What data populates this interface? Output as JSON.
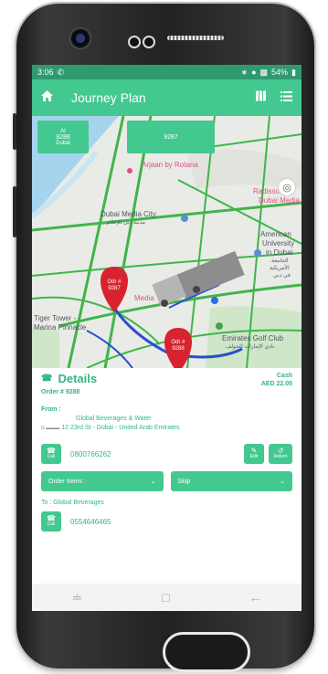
{
  "status": {
    "time": "3:06",
    "notification_icon": "whatsapp-icon",
    "battery": "54%"
  },
  "appbar": {
    "title": "Journey Plan",
    "icons": [
      "home-icon",
      "map-icon",
      "list-icon"
    ]
  },
  "map": {
    "tiles": [
      {
        "lines": [
          "At",
          "9288",
          "Dubai"
        ]
      },
      {
        "lines": [
          "9287"
        ]
      }
    ],
    "labels": {
      "arjaan": "Arjaan by Rotana",
      "media_city": "Dubai Media City",
      "media_city_ar": "مدينة دبي للإعلام",
      "radisson": "Radisson",
      "dubai_media_right": "Dubai Media",
      "american_univ": "American",
      "american_univ2": "University",
      "american_univ3": "in Dubai",
      "american_univ_ar1": "الجامعة",
      "american_univ_ar2": "الأمريكية",
      "american_univ_ar3": "في دبي",
      "media_small": "Media",
      "tiger_tower": "Tiger Tower -",
      "marina_pinnacle": "Marina Pinnacle",
      "golf_club": "Emirates Golf Club",
      "golf_club_ar": "نادي الإمارات للجولف"
    },
    "pins": [
      {
        "line1": "Odr #",
        "line2": "9287"
      },
      {
        "line1": "Odr #",
        "line2": "9288"
      }
    ]
  },
  "details": {
    "heading": "Details",
    "order": "Order # 9288",
    "payment_type": "Cash",
    "amount": "AED 22.05",
    "from_label": "From :",
    "from_name": "Global Beverages & Water",
    "from_address": "12 23rd St - Dubai - United Arab Emirates",
    "from_phone": "0800766262",
    "call_label": "Call",
    "edit_label": "Edit",
    "return_label": "Return",
    "order_items_label": "Order Items :",
    "skip_label": "Skip",
    "to_label": "To : Global Beverages",
    "to_phone": "0554646465"
  },
  "colors": {
    "primary": "#43c890",
    "status_bar": "#2e9b6f",
    "pin": "#d8232f",
    "route_blue": "#2a4fd1",
    "traffic_green": "#3fb54a"
  }
}
